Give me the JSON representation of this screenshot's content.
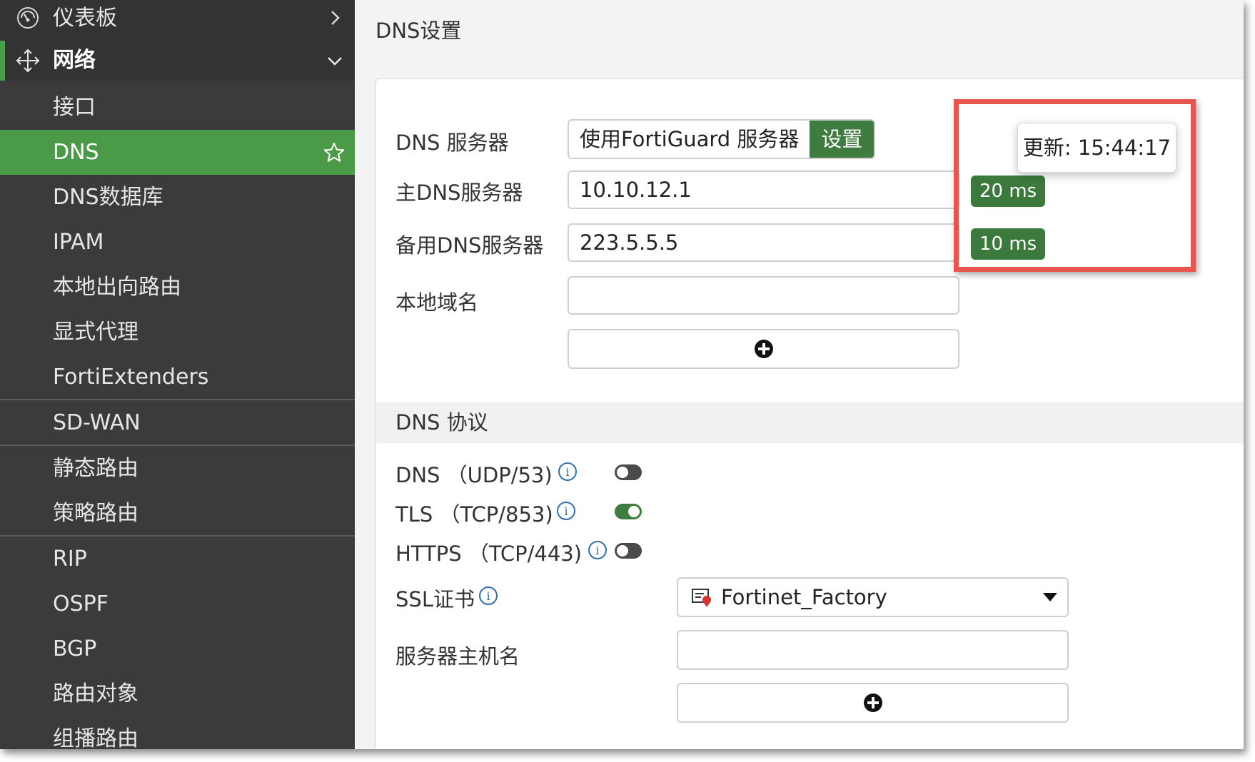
{
  "sidebar": {
    "items": [
      {
        "label": "仪表板",
        "icon": "dashboard-gauge-icon"
      },
      {
        "label": "网络",
        "icon": "move-arrows-icon"
      },
      {
        "label": "接口"
      },
      {
        "label": "DNS"
      },
      {
        "label": "DNS数据库"
      },
      {
        "label": "IPAM"
      },
      {
        "label": "本地出向路由"
      },
      {
        "label": "显式代理"
      },
      {
        "label": "FortiExtenders"
      },
      {
        "label": "SD-WAN"
      },
      {
        "label": "静态路由"
      },
      {
        "label": "策略路由"
      },
      {
        "label": "RIP"
      },
      {
        "label": "OSPF"
      },
      {
        "label": "BGP"
      },
      {
        "label": "路由对象"
      },
      {
        "label": "组播路由"
      }
    ]
  },
  "main": {
    "title": "DNS设置",
    "dns_servers": {
      "label": "DNS 服务器",
      "option_label": "使用FortiGuard 服务器",
      "set_label": "设置"
    },
    "primary_dns": {
      "label": "主DNS服务器",
      "value": "10.10.12.1",
      "latency": "20 ms"
    },
    "secondary_dns": {
      "label": "备用DNS服务器",
      "value": "223.5.5.5",
      "latency": "10 ms"
    },
    "local_domain": {
      "label": "本地域名",
      "value": ""
    },
    "tooltip": "更新: 15:44:17",
    "protocol_section": {
      "title": "DNS 协议",
      "protocols": [
        {
          "label": "DNS （UDP/53)",
          "enabled": false
        },
        {
          "label": "TLS （TCP/853)",
          "enabled": true
        },
        {
          "label": "HTTPS （TCP/443)",
          "enabled": false
        }
      ],
      "ssl_cert": {
        "label": "SSL证书",
        "value": "Fortinet_Factory"
      },
      "server_hostname": {
        "label": "服务器主机名",
        "value": ""
      }
    }
  },
  "colors": {
    "accent_green": "#4a9a48",
    "button_green": "#3e7d3f",
    "highlight_red": "#e8554e",
    "sidebar_bg": "#3b3b3b"
  }
}
